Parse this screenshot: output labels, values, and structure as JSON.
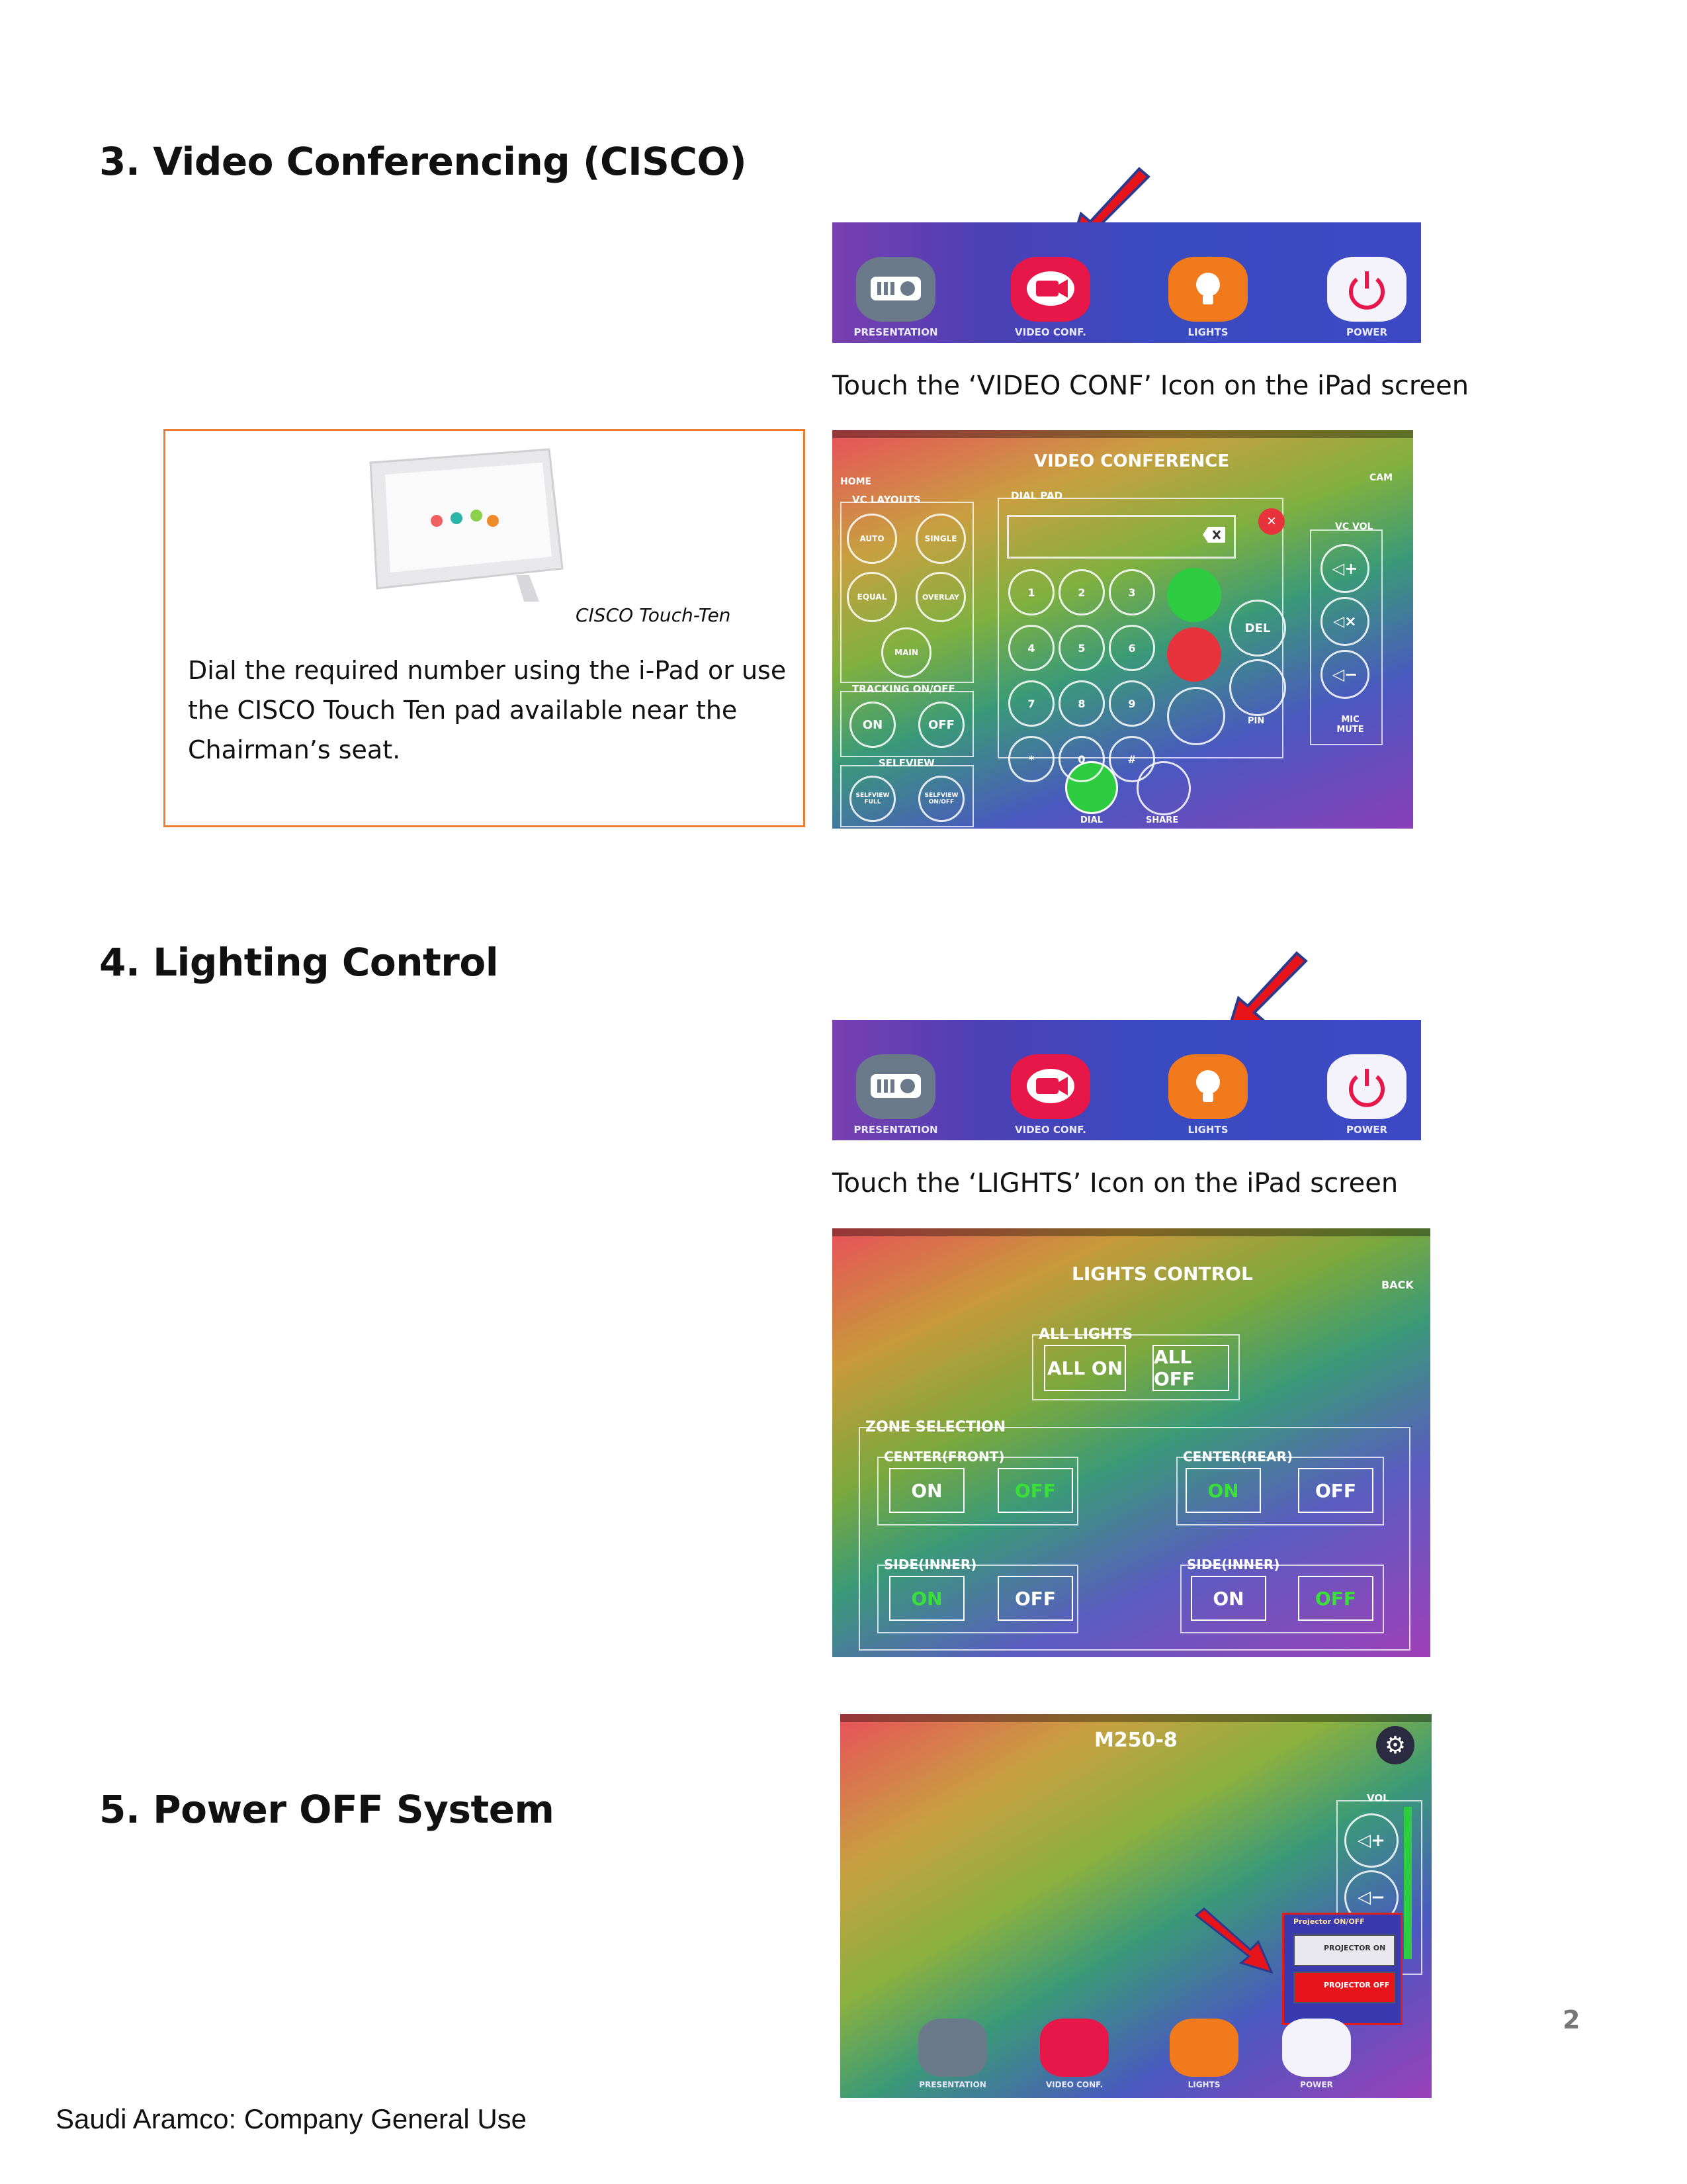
{
  "section3": {
    "heading": "3. Video Conferencing (CISCO)",
    "caption": "Touch the ‘VIDEO CONF’ Icon on the iPad screen",
    "callout": {
      "device_caption": "CISCO Touch-Ten",
      "text_line1": "Dial the required number using the i-Pad or use",
      "text_line2": "the CISCO Touch Ten pad available near the",
      "text_line3": "Chairman’s seat."
    }
  },
  "section4": {
    "heading": "4. Lighting Control",
    "caption": "Touch the ‘LIGHTS’ Icon on the iPad screen"
  },
  "section5": {
    "heading": "5. Power OFF System"
  },
  "menu_bar": {
    "presentation": "PRESENTATION",
    "video_conf": "VIDEO CONF.",
    "lights": "LIGHTS",
    "power": "POWER"
  },
  "vc_screen": {
    "title": "VIDEO CONFERENCE",
    "home": "HOME",
    "cam": "CAM",
    "vc_layouts": "VC LAYOUTS",
    "auto": "AUTO",
    "single": "SINGLE",
    "equal": "EQUAL",
    "overlay": "OVERLAY",
    "main": "MAIN",
    "tracking": "TRACKING ON/OFF",
    "on": "ON",
    "off": "OFF",
    "selfview": "SELFVIEW",
    "selfview_full": "SELFVIEW FULL",
    "selfview_onoff": "SELFVIEW ON/OFF",
    "dial_pad": "DIAL PAD",
    "keys": [
      "1",
      "2",
      "3",
      "4",
      "5",
      "6",
      "7",
      "8",
      "9",
      "*",
      "0",
      "#"
    ],
    "del": "DEL",
    "pin": "PIN",
    "vc_vol": "VC VOL",
    "mic_mute": "MIC MUTE",
    "dial": "DIAL",
    "share": "SHARE"
  },
  "lights_screen": {
    "title": "LIGHTS CONTROL",
    "back": "BACK",
    "all_lights": "ALL LIGHTS",
    "all_on": "ALL ON",
    "all_off": "ALL OFF",
    "zone_selection": "ZONE SELECTION",
    "center_front": "CENTER(FRONT)",
    "center_rear": "CENTER(REAR)",
    "side_inner_left": "SIDE(INNER)",
    "side_inner_right": "SIDE(INNER)",
    "on": "ON",
    "off": "OFF"
  },
  "home_screen": {
    "title": "M250-8",
    "vol": "VOL",
    "projector_header": "Projector ON/OFF",
    "projector_on": "PROJECTOR ON",
    "projector_off": "PROJECTOR OFF"
  },
  "page_number": "2",
  "footer": "Saudi Aramco: Company General Use"
}
